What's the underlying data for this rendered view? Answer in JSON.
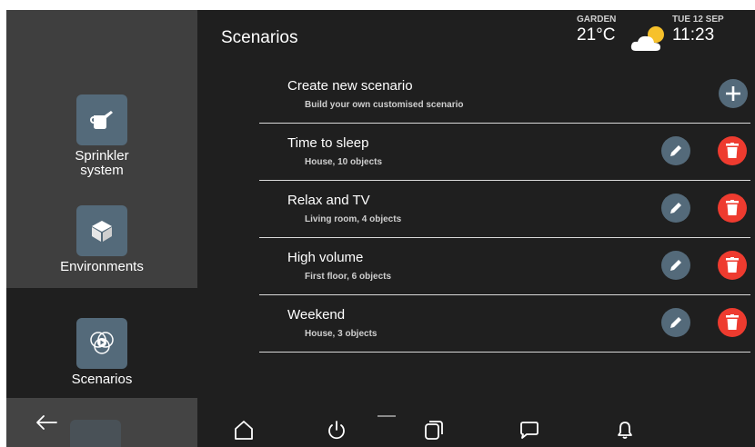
{
  "header": {
    "title": "Scenarios",
    "weather": {
      "location": "GARDEN",
      "temperature": "21°C",
      "icon": "partly-cloudy-icon"
    },
    "datetime": {
      "date": "TUE 12 SEP",
      "time": "11:23"
    }
  },
  "sidebar": {
    "items": [
      {
        "label_line1": "Sprinkler",
        "label_line2": "system",
        "icon": "watering-can-icon"
      },
      {
        "label": "Environments",
        "icon": "cube-icon"
      },
      {
        "label": "Scenarios",
        "icon": "scenario-play-icon",
        "active": true
      }
    ],
    "back_icon": "back-arrow-icon"
  },
  "scenarios": {
    "create": {
      "title": "Create new scenario",
      "subtitle": "Build your own customised scenario",
      "icon": "plus-icon"
    },
    "items": [
      {
        "title": "Time to sleep",
        "subtitle": "House, 10 objects"
      },
      {
        "title": "Relax and TV",
        "subtitle": "Living room, 4 objects"
      },
      {
        "title": "High volume",
        "subtitle": "First floor, 6 objects"
      },
      {
        "title": "Weekend",
        "subtitle": "House, 3 objects"
      }
    ],
    "edit_icon": "pencil-icon",
    "delete_icon": "trash-icon"
  },
  "bottom_nav": {
    "icons": [
      "home-icon",
      "power-icon",
      "multi-window-icon",
      "message-icon",
      "bell-icon"
    ]
  },
  "colors": {
    "background": "#1f1f1f",
    "sidebar": "#3f3f3f",
    "accent_tile": "#546a7a",
    "delete": "#ee3b2f",
    "divider": "#d9d9d9"
  }
}
